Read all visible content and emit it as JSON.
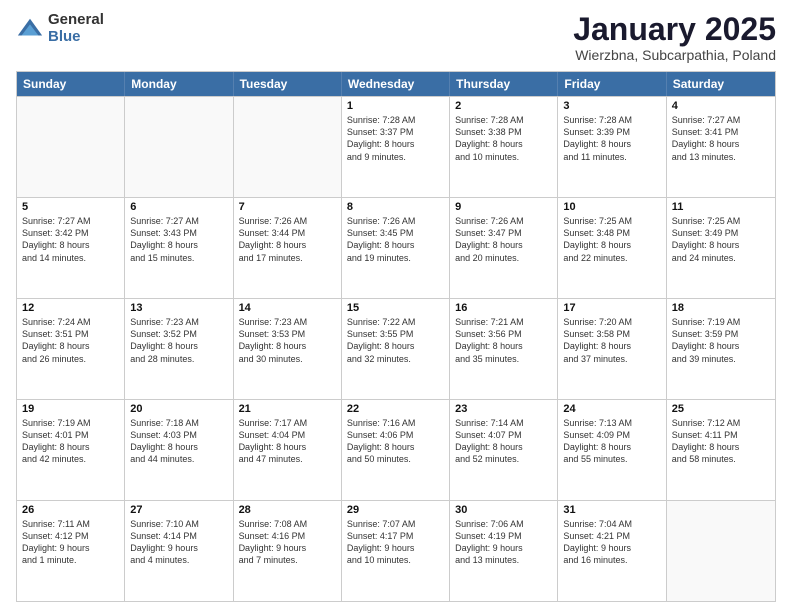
{
  "logo": {
    "general": "General",
    "blue": "Blue"
  },
  "title": "January 2025",
  "subtitle": "Wierzbna, Subcarpathia, Poland",
  "header_days": [
    "Sunday",
    "Monday",
    "Tuesday",
    "Wednesday",
    "Thursday",
    "Friday",
    "Saturday"
  ],
  "weeks": [
    [
      {
        "day": "",
        "empty": true
      },
      {
        "day": "",
        "empty": true
      },
      {
        "day": "",
        "empty": true
      },
      {
        "day": "1",
        "lines": [
          "Sunrise: 7:28 AM",
          "Sunset: 3:37 PM",
          "Daylight: 8 hours",
          "and 9 minutes."
        ]
      },
      {
        "day": "2",
        "lines": [
          "Sunrise: 7:28 AM",
          "Sunset: 3:38 PM",
          "Daylight: 8 hours",
          "and 10 minutes."
        ]
      },
      {
        "day": "3",
        "lines": [
          "Sunrise: 7:28 AM",
          "Sunset: 3:39 PM",
          "Daylight: 8 hours",
          "and 11 minutes."
        ]
      },
      {
        "day": "4",
        "lines": [
          "Sunrise: 7:27 AM",
          "Sunset: 3:41 PM",
          "Daylight: 8 hours",
          "and 13 minutes."
        ]
      }
    ],
    [
      {
        "day": "5",
        "lines": [
          "Sunrise: 7:27 AM",
          "Sunset: 3:42 PM",
          "Daylight: 8 hours",
          "and 14 minutes."
        ]
      },
      {
        "day": "6",
        "lines": [
          "Sunrise: 7:27 AM",
          "Sunset: 3:43 PM",
          "Daylight: 8 hours",
          "and 15 minutes."
        ]
      },
      {
        "day": "7",
        "lines": [
          "Sunrise: 7:26 AM",
          "Sunset: 3:44 PM",
          "Daylight: 8 hours",
          "and 17 minutes."
        ]
      },
      {
        "day": "8",
        "lines": [
          "Sunrise: 7:26 AM",
          "Sunset: 3:45 PM",
          "Daylight: 8 hours",
          "and 19 minutes."
        ]
      },
      {
        "day": "9",
        "lines": [
          "Sunrise: 7:26 AM",
          "Sunset: 3:47 PM",
          "Daylight: 8 hours",
          "and 20 minutes."
        ]
      },
      {
        "day": "10",
        "lines": [
          "Sunrise: 7:25 AM",
          "Sunset: 3:48 PM",
          "Daylight: 8 hours",
          "and 22 minutes."
        ]
      },
      {
        "day": "11",
        "lines": [
          "Sunrise: 7:25 AM",
          "Sunset: 3:49 PM",
          "Daylight: 8 hours",
          "and 24 minutes."
        ]
      }
    ],
    [
      {
        "day": "12",
        "lines": [
          "Sunrise: 7:24 AM",
          "Sunset: 3:51 PM",
          "Daylight: 8 hours",
          "and 26 minutes."
        ]
      },
      {
        "day": "13",
        "lines": [
          "Sunrise: 7:23 AM",
          "Sunset: 3:52 PM",
          "Daylight: 8 hours",
          "and 28 minutes."
        ]
      },
      {
        "day": "14",
        "lines": [
          "Sunrise: 7:23 AM",
          "Sunset: 3:53 PM",
          "Daylight: 8 hours",
          "and 30 minutes."
        ]
      },
      {
        "day": "15",
        "lines": [
          "Sunrise: 7:22 AM",
          "Sunset: 3:55 PM",
          "Daylight: 8 hours",
          "and 32 minutes."
        ]
      },
      {
        "day": "16",
        "lines": [
          "Sunrise: 7:21 AM",
          "Sunset: 3:56 PM",
          "Daylight: 8 hours",
          "and 35 minutes."
        ]
      },
      {
        "day": "17",
        "lines": [
          "Sunrise: 7:20 AM",
          "Sunset: 3:58 PM",
          "Daylight: 8 hours",
          "and 37 minutes."
        ]
      },
      {
        "day": "18",
        "lines": [
          "Sunrise: 7:19 AM",
          "Sunset: 3:59 PM",
          "Daylight: 8 hours",
          "and 39 minutes."
        ]
      }
    ],
    [
      {
        "day": "19",
        "lines": [
          "Sunrise: 7:19 AM",
          "Sunset: 4:01 PM",
          "Daylight: 8 hours",
          "and 42 minutes."
        ]
      },
      {
        "day": "20",
        "lines": [
          "Sunrise: 7:18 AM",
          "Sunset: 4:03 PM",
          "Daylight: 8 hours",
          "and 44 minutes."
        ]
      },
      {
        "day": "21",
        "lines": [
          "Sunrise: 7:17 AM",
          "Sunset: 4:04 PM",
          "Daylight: 8 hours",
          "and 47 minutes."
        ]
      },
      {
        "day": "22",
        "lines": [
          "Sunrise: 7:16 AM",
          "Sunset: 4:06 PM",
          "Daylight: 8 hours",
          "and 50 minutes."
        ]
      },
      {
        "day": "23",
        "lines": [
          "Sunrise: 7:14 AM",
          "Sunset: 4:07 PM",
          "Daylight: 8 hours",
          "and 52 minutes."
        ]
      },
      {
        "day": "24",
        "lines": [
          "Sunrise: 7:13 AM",
          "Sunset: 4:09 PM",
          "Daylight: 8 hours",
          "and 55 minutes."
        ]
      },
      {
        "day": "25",
        "lines": [
          "Sunrise: 7:12 AM",
          "Sunset: 4:11 PM",
          "Daylight: 8 hours",
          "and 58 minutes."
        ]
      }
    ],
    [
      {
        "day": "26",
        "lines": [
          "Sunrise: 7:11 AM",
          "Sunset: 4:12 PM",
          "Daylight: 9 hours",
          "and 1 minute."
        ]
      },
      {
        "day": "27",
        "lines": [
          "Sunrise: 7:10 AM",
          "Sunset: 4:14 PM",
          "Daylight: 9 hours",
          "and 4 minutes."
        ]
      },
      {
        "day": "28",
        "lines": [
          "Sunrise: 7:08 AM",
          "Sunset: 4:16 PM",
          "Daylight: 9 hours",
          "and 7 minutes."
        ]
      },
      {
        "day": "29",
        "lines": [
          "Sunrise: 7:07 AM",
          "Sunset: 4:17 PM",
          "Daylight: 9 hours",
          "and 10 minutes."
        ]
      },
      {
        "day": "30",
        "lines": [
          "Sunrise: 7:06 AM",
          "Sunset: 4:19 PM",
          "Daylight: 9 hours",
          "and 13 minutes."
        ]
      },
      {
        "day": "31",
        "lines": [
          "Sunrise: 7:04 AM",
          "Sunset: 4:21 PM",
          "Daylight: 9 hours",
          "and 16 minutes."
        ]
      },
      {
        "day": "",
        "empty": true
      }
    ]
  ]
}
